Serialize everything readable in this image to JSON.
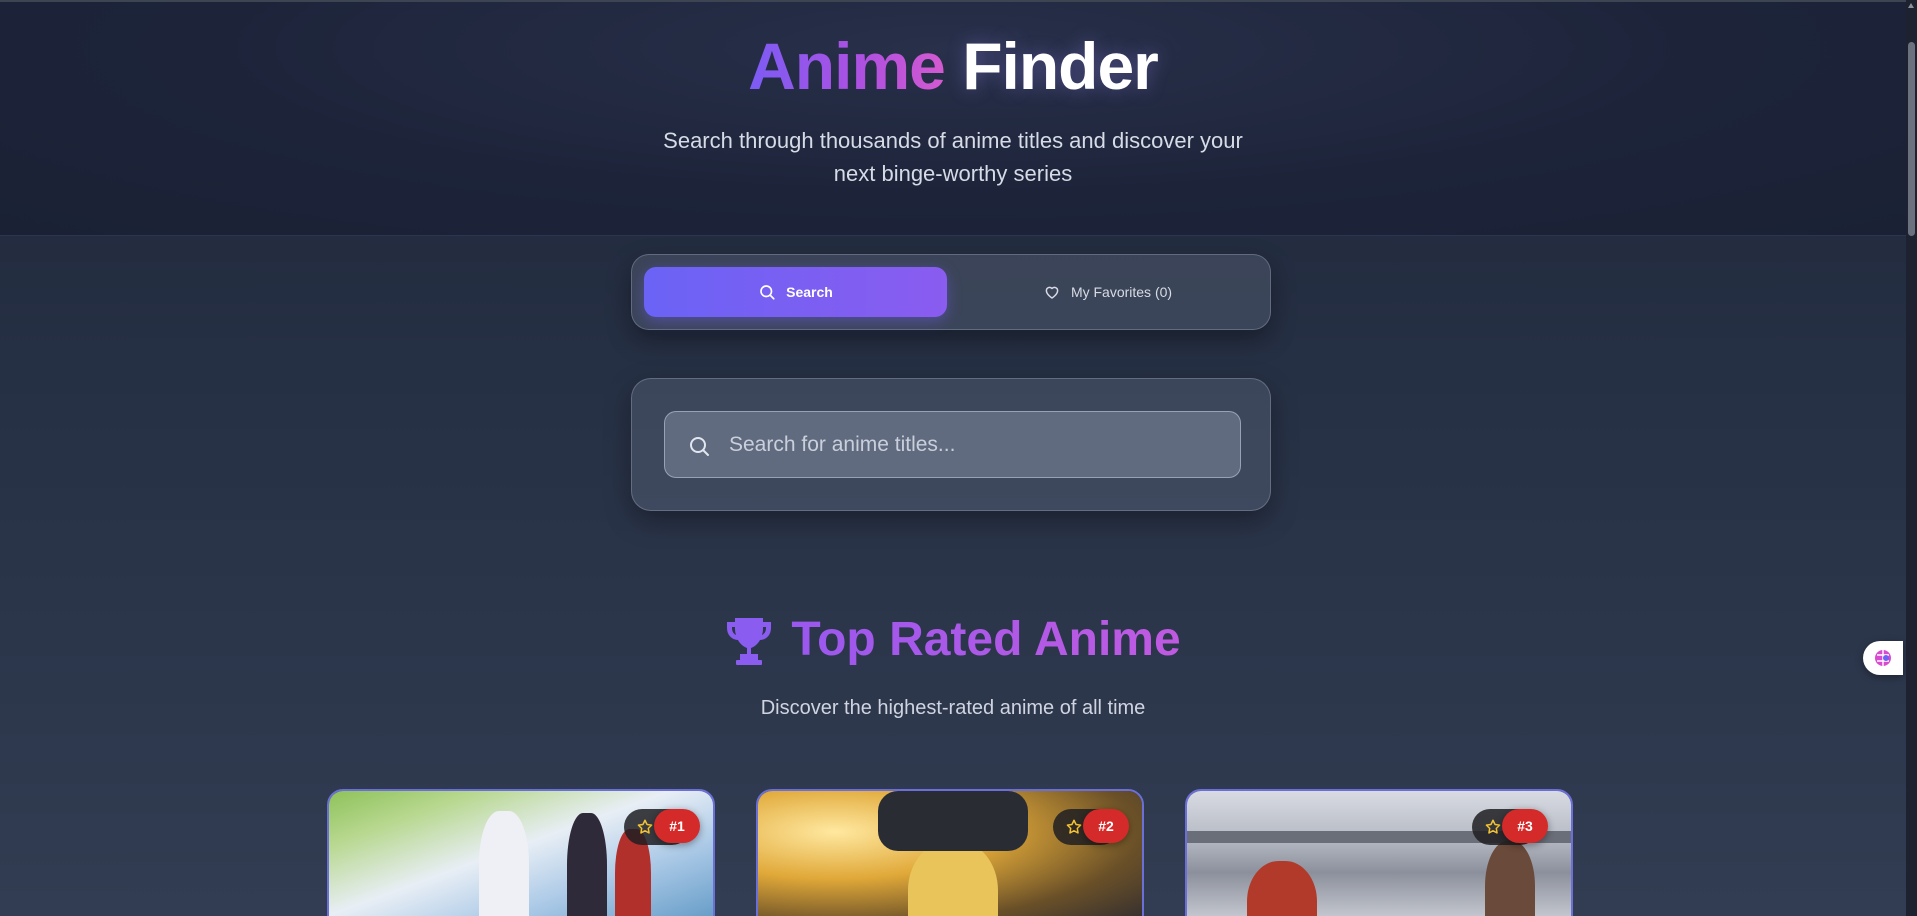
{
  "hero": {
    "title_accent": "Anime",
    "title_plain": "Finder",
    "subtitle": "Search through thousands of anime titles and discover your next binge-worthy series"
  },
  "tabs": [
    {
      "label": "Search",
      "icon": "search-icon",
      "active": true
    },
    {
      "label": "My Favorites (0)",
      "icon": "heart-icon",
      "active": false
    }
  ],
  "search": {
    "placeholder": "Search for anime titles...",
    "value": ""
  },
  "top_rated": {
    "title": "Top Rated Anime",
    "icon": "trophy-icon",
    "subtitle": "Discover the highest-rated anime of all time",
    "cards": [
      {
        "rank": "#1"
      },
      {
        "rank": "#2"
      },
      {
        "rank": "#3"
      }
    ]
  },
  "colors": {
    "accent_gradient_start": "#6a63f5",
    "accent_gradient_end": "#8a5cf0",
    "title_purple": "#9a58ee",
    "rank_badge": "#d42a2a",
    "star": "#f5c431",
    "background": "#2a3244"
  }
}
